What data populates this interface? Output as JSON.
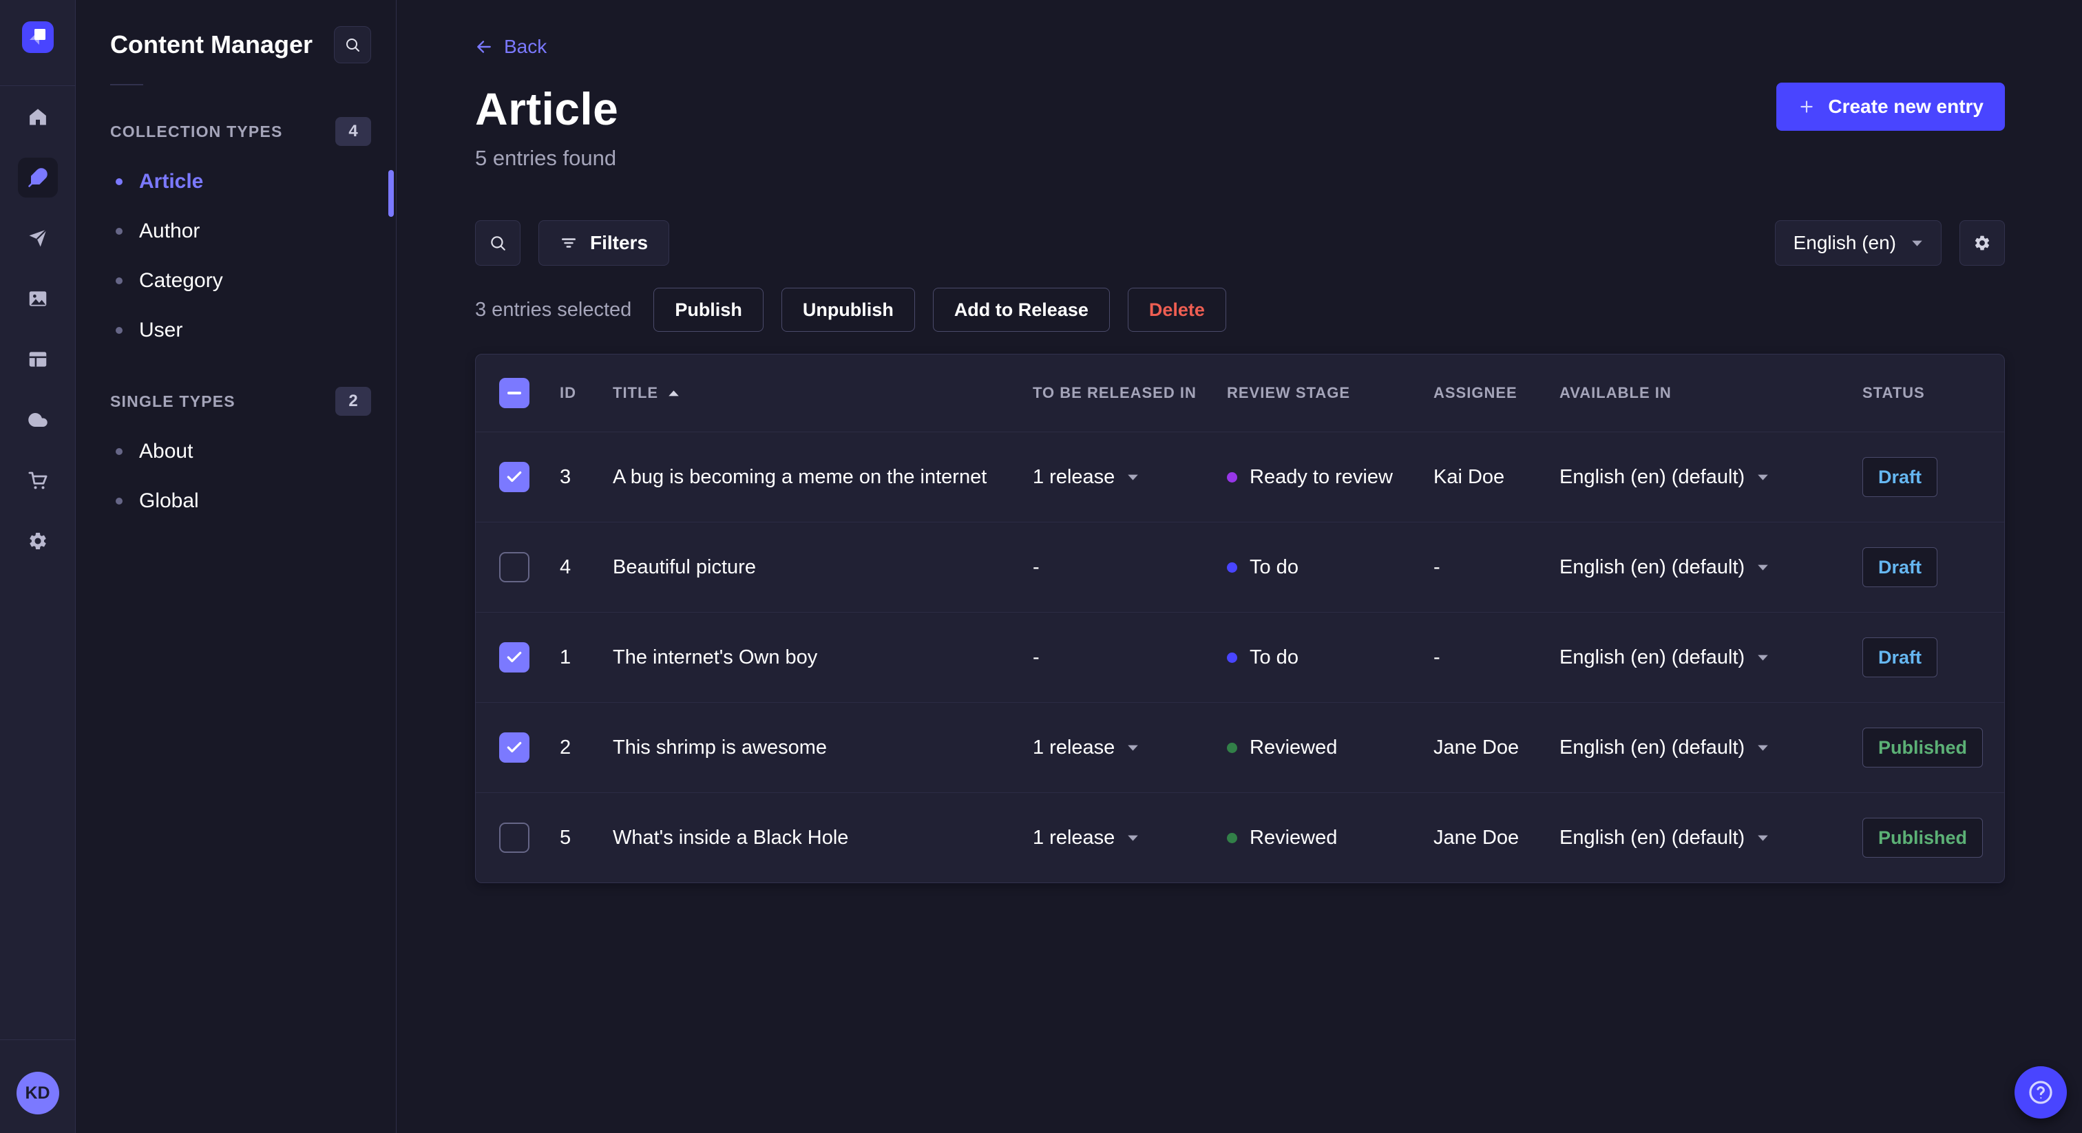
{
  "main_nav": {
    "items": [
      {
        "icon": "home",
        "active": false
      },
      {
        "icon": "content-manager",
        "active": true
      },
      {
        "icon": "releases",
        "active": false
      },
      {
        "icon": "media-library",
        "active": false
      },
      {
        "icon": "content-type-builder",
        "active": false
      },
      {
        "icon": "deploy",
        "active": false
      },
      {
        "icon": "marketplace",
        "active": false
      },
      {
        "icon": "settings",
        "active": false
      }
    ]
  },
  "user": {
    "initials": "KD"
  },
  "subnav": {
    "title": "Content Manager",
    "sections": [
      {
        "label": "COLLECTION TYPES",
        "count": "4",
        "items": [
          {
            "label": "Article",
            "active": true
          },
          {
            "label": "Author",
            "active": false
          },
          {
            "label": "Category",
            "active": false
          },
          {
            "label": "User",
            "active": false
          }
        ]
      },
      {
        "label": "SINGLE TYPES",
        "count": "2",
        "items": [
          {
            "label": "About",
            "active": false
          },
          {
            "label": "Global",
            "active": false
          }
        ]
      }
    ]
  },
  "header": {
    "back_label": "Back",
    "title": "Article",
    "subtitle": "5 entries found",
    "create_label": "Create new entry"
  },
  "toolbar": {
    "filters_label": "Filters",
    "locale_value": "English (en)"
  },
  "selection": {
    "text": "3 entries selected",
    "actions": [
      {
        "label": "Publish",
        "danger": false
      },
      {
        "label": "Unpublish",
        "danger": false
      },
      {
        "label": "Add to Release",
        "danger": false
      },
      {
        "label": "Delete",
        "danger": true
      }
    ]
  },
  "table": {
    "columns": [
      "ID",
      "TITLE",
      "TO BE RELEASED IN",
      "REVIEW STAGE",
      "ASSIGNEE",
      "AVAILABLE IN",
      "STATUS"
    ],
    "sort_column": "TITLE",
    "sort_direction": "asc",
    "rows": [
      {
        "selected": true,
        "id": "3",
        "title": "A bug is becoming a meme on the internet",
        "to_be_released_in": "1 release",
        "release_expandable": true,
        "review_stage": {
          "label": "Ready to review",
          "color": "#9736e8"
        },
        "assignee": "Kai Doe",
        "available_in": "English (en) (default)",
        "status": {
          "label": "Draft",
          "color": "#66b7f1"
        }
      },
      {
        "selected": false,
        "id": "4",
        "title": "Beautiful picture",
        "to_be_released_in": "-",
        "release_expandable": false,
        "review_stage": {
          "label": "To do",
          "color": "#4945ff"
        },
        "assignee": "-",
        "available_in": "English (en) (default)",
        "status": {
          "label": "Draft",
          "color": "#66b7f1"
        }
      },
      {
        "selected": true,
        "id": "1",
        "title": "The internet's Own boy",
        "to_be_released_in": "-",
        "release_expandable": false,
        "review_stage": {
          "label": "To do",
          "color": "#4945ff"
        },
        "assignee": "-",
        "available_in": "English (en) (default)",
        "status": {
          "label": "Draft",
          "color": "#66b7f1"
        }
      },
      {
        "selected": true,
        "id": "2",
        "title": "This shrimp is awesome",
        "to_be_released_in": "1 release",
        "release_expandable": true,
        "review_stage": {
          "label": "Reviewed",
          "color": "#328048"
        },
        "assignee": "Jane Doe",
        "available_in": "English (en) (default)",
        "status": {
          "label": "Published",
          "color": "#5cb176"
        }
      },
      {
        "selected": false,
        "id": "5",
        "title": "What's inside a Black Hole",
        "to_be_released_in": "1 release",
        "release_expandable": true,
        "review_stage": {
          "label": "Reviewed",
          "color": "#328048"
        },
        "assignee": "Jane Doe",
        "available_in": "English (en) (default)",
        "status": {
          "label": "Published",
          "color": "#5cb176"
        }
      }
    ]
  },
  "colors": {
    "primary": "#4945ff",
    "primary_light": "#7b79ff",
    "danger": "#ee5e52",
    "draft": "#66b7f1",
    "published": "#5cb176"
  }
}
